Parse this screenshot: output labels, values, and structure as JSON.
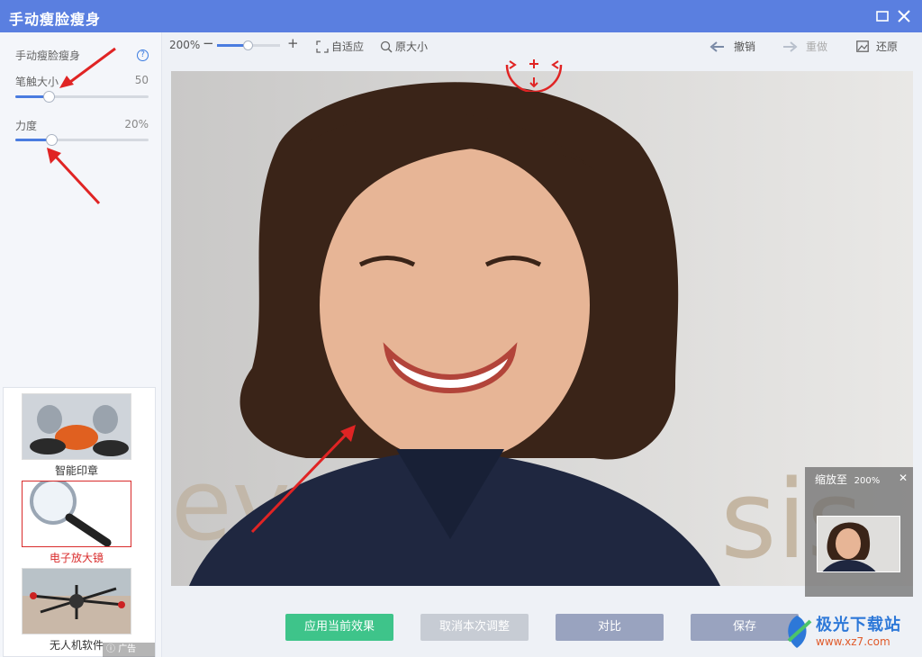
{
  "window": {
    "title": "手动瘦脸瘦身"
  },
  "sidebar": {
    "heading": "手动瘦脸瘦身",
    "brush": {
      "label": "笔触大小",
      "value": "50",
      "level": 0.25
    },
    "strength": {
      "label": "力度",
      "value": "20%",
      "level": 0.27
    }
  },
  "ads": {
    "items": [
      {
        "caption": "智能印章",
        "icon": "stamp-image"
      },
      {
        "caption": "电子放大镜",
        "icon": "magnifier-image",
        "active": true
      },
      {
        "caption": "无人机软件",
        "icon": "drone-image"
      }
    ],
    "badge": "广告"
  },
  "toolbar": {
    "zoom": "200%",
    "zoom_minus": "−",
    "zoom_plus": "+",
    "fit": "自适应",
    "original": "原大小",
    "undo": "撤销",
    "redo": "重做",
    "restore": "还原"
  },
  "minimap": {
    "title": "缩放至",
    "zoom": "200%"
  },
  "buttons": {
    "apply": "应用当前效果",
    "cancel": "取消本次调整",
    "compare": "对比",
    "save": "保存"
  },
  "watermark": {
    "name": "极光下载站",
    "url": "www.xz7.com"
  },
  "colors": {
    "titlebar": "#5a7fe0",
    "accent": "#4a7ce0",
    "apply": "#3ec48a",
    "arrow": "#e02424"
  }
}
